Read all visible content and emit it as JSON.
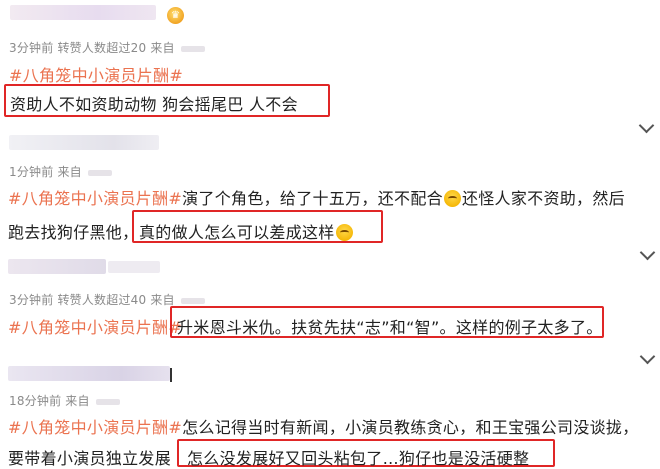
{
  "comments": [
    {
      "meta": "3分钟前  转赞人数超过20  来自",
      "hashtag": "#八角笼中小演员片酬#",
      "lines": [
        "资助人不如资助动物 狗会摇尾巴 人不会"
      ]
    },
    {
      "meta": "1分钟前  来自",
      "hashtag": "#八角笼中小演员片酬#",
      "line1_after_tag": "演了个角色，给了十五万，还不配合",
      "line1_tail": "还怪人家不资助，然后",
      "line2_pre": "跑去找狗仔黑他，",
      "line2_boxed": "真的做人怎么可以差成这样"
    },
    {
      "meta": "3分钟前  转赞人数超过40  来自",
      "hashtag": "#八角笼中小演员片酬#",
      "line_boxed": "升米恩斗米仇。扶贫先扶“志”和“智”。这样的例子太多了。"
    },
    {
      "meta": "18分钟前  来自",
      "hashtag": "#八角笼中小演员片酬#",
      "line1_after_tag": "怎么记得当时有新闻，小演员教练贪心，和王宝强公司没谈拢，",
      "line2_pre": "要带着小演员独立发展",
      "line2_boxed": "怎么没发展好又回头粘包了…狗仔也是没活硬整"
    }
  ],
  "icons": {
    "crown": "vip-crown-icon",
    "chevron": "chevron-down-icon",
    "emoji": "sweat-face-emoji"
  },
  "colors": {
    "hashtag": "#eb7350",
    "highlight_box": "#e02626",
    "meta": "#8a8a8a"
  }
}
